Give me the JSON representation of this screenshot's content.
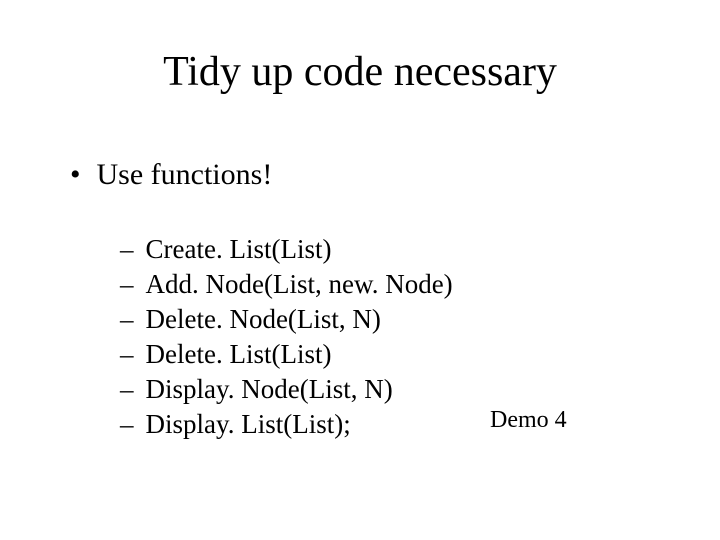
{
  "title": "Tidy up code necessary",
  "bullet": "Use functions!",
  "functions": [
    "Create. List(List)",
    "Add. Node(List, new. Node)",
    "Delete. Node(List, N)",
    "Delete. List(List)",
    "Display. Node(List, N)",
    "Display. List(List);"
  ],
  "demo_label": "Demo 4"
}
